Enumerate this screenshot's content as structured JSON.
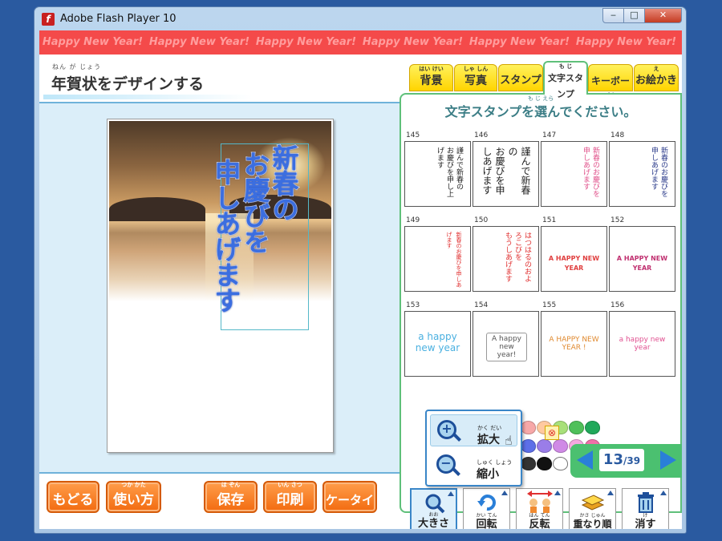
{
  "window": {
    "title": "Adobe Flash Player 10",
    "minimize": "‒",
    "maximize": "□",
    "close": "✕"
  },
  "banner": {
    "text": "Happy New Year!"
  },
  "header": {
    "title": "年賀状をデザインする",
    "title_ruby": "ねん が じょう"
  },
  "card": {
    "stamp_text": [
      "新春の",
      "お慶びを",
      "申しあげます"
    ]
  },
  "tabs": [
    {
      "ruby": "はい けい",
      "label": "背景"
    },
    {
      "ruby": "しゃ しん",
      "label": "写真"
    },
    {
      "ruby": "",
      "label": "スタンプ"
    },
    {
      "ruby": "も じ",
      "label": "文字スタンプ"
    },
    {
      "ruby": "",
      "label": "キーボード"
    },
    {
      "ruby": "え",
      "label": "お絵かき"
    }
  ],
  "panel": {
    "heading": "文字スタンプを選んでください。",
    "heading_ruby": "も じ          えら"
  },
  "stamps": [
    {
      "num": "145",
      "text": "謹んで新春の\nお慶びを申し上げます"
    },
    {
      "num": "146",
      "text": "謹んで新春の\nお慶びを申しあげます"
    },
    {
      "num": "147",
      "text": "新春のお慶びを\n申しあげます"
    },
    {
      "num": "148",
      "text": "新春のお慶びを\n申しあげます"
    },
    {
      "num": "149",
      "text": "新春のお慶びを申しあげます"
    },
    {
      "num": "150",
      "text": "はつはるのおよろこびを\nもうしあげます"
    },
    {
      "num": "151",
      "text": "A HAPPY NEW YEAR"
    },
    {
      "num": "152",
      "text": "A HAPPY NEW YEAR"
    },
    {
      "num": "153",
      "text": "a happy new year"
    },
    {
      "num": "154",
      "text": "A happy new year!"
    },
    {
      "num": "155",
      "text": "A HAPPY NEW YEAR !"
    },
    {
      "num": "156",
      "text": "a happy new year"
    }
  ],
  "colors": [
    "#f7a8a8",
    "#ffc9a0",
    "#a8e07a",
    "#4fc05a",
    "#21a85a",
    "#5d6fe8",
    "#9a7de8",
    "#d08ae6",
    "#f5a8e0",
    "#f070a8",
    "#333333",
    "#111111",
    "#ffffff"
  ],
  "pager": {
    "current": "13",
    "total": "/39"
  },
  "zoom_menu": {
    "zoom_in_label": "拡大",
    "zoom_in_ruby": "かく だい",
    "zoom_out_label": "縮小",
    "zoom_out_ruby": "しゅく しょう"
  },
  "tools": [
    {
      "ruby": "おお",
      "label": "大きさ"
    },
    {
      "ruby": "かい てん",
      "label": "回転"
    },
    {
      "ruby": "はん てん",
      "label": "反転"
    },
    {
      "ruby": "かさ   じゅん",
      "label": "重なり順"
    },
    {
      "ruby": "け",
      "label": "消す"
    }
  ],
  "bottom_buttons": [
    {
      "ruby": "",
      "label": "もどる"
    },
    {
      "ruby": "つか  かた",
      "label": "使い方"
    },
    {
      "ruby": "ほ ぞん",
      "label": "保存"
    },
    {
      "ruby": "いん さつ",
      "label": "印刷"
    },
    {
      "ruby": "",
      "label": "ケータイ"
    }
  ]
}
